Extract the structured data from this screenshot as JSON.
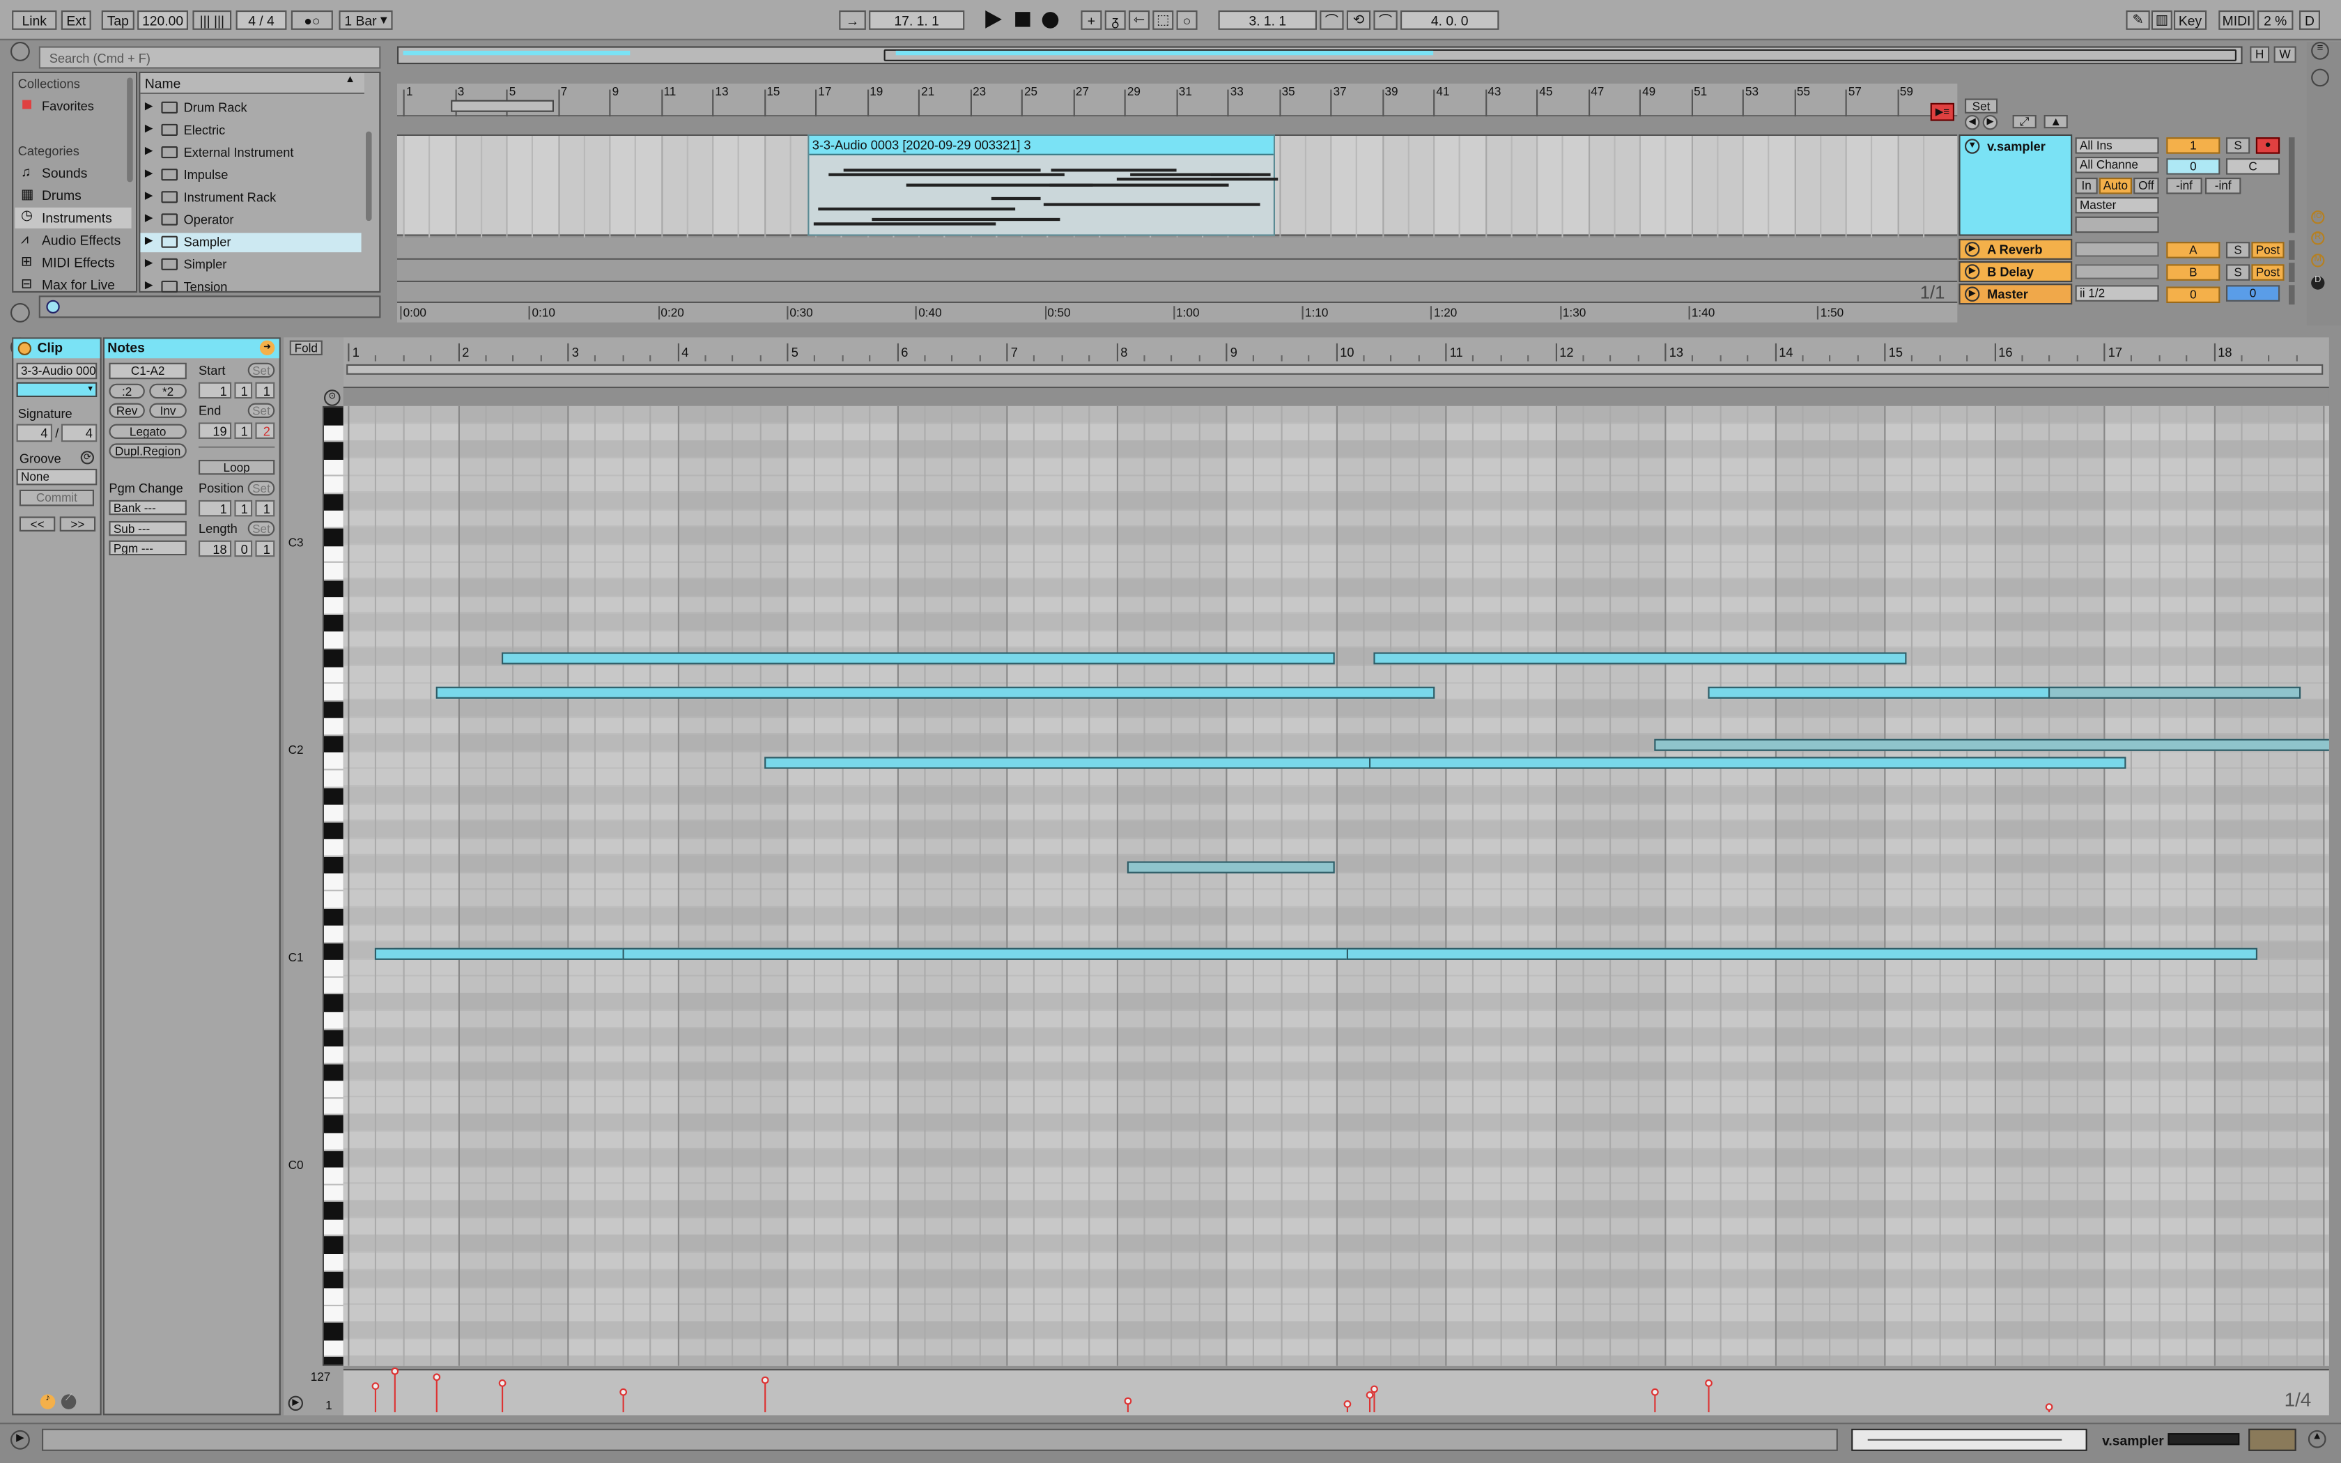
{
  "transport": {
    "link": "Link",
    "ext": "Ext",
    "tap": "Tap",
    "tempo": "120.00",
    "signature": "4 / 4",
    "metronome": "●○",
    "quantize": "1 Bar",
    "position": "17. 1. 1",
    "loop_start": "3. 1. 1",
    "loop_length": "4. 0. 0",
    "key": "Key",
    "midi": "MIDI",
    "cpu": "2 %",
    "disk": "D"
  },
  "browser": {
    "search_placeholder": "Search (Cmd + F)",
    "collections_title": "Collections",
    "favorites": "Favorites",
    "categories_title": "Categories",
    "categories": [
      "Sounds",
      "Drums",
      "Instruments",
      "Audio Effects",
      "MIDI Effects",
      "Max for Live"
    ],
    "name_header": "Name",
    "items": [
      "Drum Rack",
      "Electric",
      "External Instrument",
      "Impulse",
      "Instrument Rack",
      "Operator",
      "Sampler",
      "Simpler",
      "Tension"
    ]
  },
  "arrangement": {
    "bar_labels": [
      "1",
      "3",
      "5",
      "7",
      "9",
      "11",
      "13",
      "15",
      "17",
      "19",
      "21",
      "23",
      "25",
      "27",
      "29",
      "31",
      "33",
      "35",
      "37",
      "39",
      "41",
      "43",
      "45",
      "47",
      "49",
      "51",
      "53",
      "55",
      "57",
      "59"
    ],
    "clip_name": "3-3-Audio 0003 [2020-09-29 003321] 3",
    "time_labels": [
      "0:00",
      "0:10",
      "0:20",
      "0:30",
      "0:40",
      "0:50",
      "1:00",
      "1:10",
      "1:20",
      "1:30",
      "1:40",
      "1:50"
    ],
    "set_label": "Set",
    "page": "1/1",
    "h": "H",
    "w": "W"
  },
  "tracks": {
    "main": {
      "name": "v.sampler",
      "input": "All Ins",
      "channel": "All Channe",
      "in": "In",
      "auto": "Auto",
      "off": "Off",
      "output": "Master",
      "number": "1",
      "s": "S",
      "volume": "0",
      "pan": "C",
      "inf1": "-inf",
      "inf2": "-inf"
    },
    "returns": [
      {
        "name": "A Reverb",
        "letter": "A",
        "s": "S",
        "post": "Post"
      },
      {
        "name": "B Delay",
        "letter": "B",
        "s": "S",
        "post": "Post"
      },
      {
        "name": "Master",
        "letter": "0",
        "s": "",
        "post": "",
        "cue": "ii 1/2"
      }
    ],
    "master_vol": "0"
  },
  "clip_view": {
    "clip_title": "Clip",
    "clip_name": "3-3-Audio 000",
    "signature_label": "Signature",
    "sig_num": "4",
    "sig_den": "4",
    "groove_label": "Groove",
    "groove_value": "None",
    "commit": "Commit",
    "nav_left": "<<",
    "nav_right": ">>"
  },
  "notes_view": {
    "title": "Notes",
    "range": "C1-A2",
    "div2": ":2",
    "mul2": "*2",
    "rev": "Rev",
    "inv": "Inv",
    "legato": "Legato",
    "dupl": "Dupl.Region",
    "pgm_change": "Pgm Change",
    "bank": "Bank ---",
    "sub": "Sub ---",
    "pgm": "Pgm ---",
    "start_label": "Start",
    "start": [
      "1",
      "1",
      "1"
    ],
    "end_label": "End",
    "end": [
      "19",
      "1",
      "2"
    ],
    "loop": "Loop",
    "position_label": "Position",
    "position": [
      "1",
      "1",
      "1"
    ],
    "length_label": "Length",
    "length": [
      "18",
      "0",
      "1"
    ],
    "set": "Set"
  },
  "editor": {
    "fold": "Fold",
    "bar_labels": [
      "1",
      "2",
      "3",
      "4",
      "5",
      "6",
      "7",
      "8",
      "9",
      "10",
      "11",
      "12",
      "13",
      "14",
      "15",
      "16",
      "17",
      "18"
    ],
    "octave_labels": [
      "C3",
      "C2",
      "C1",
      "C0"
    ],
    "vel_max": "127",
    "vel_min": "1",
    "grid": "1/4"
  },
  "notes": [
    {
      "start": 1.42,
      "end": 8.99,
      "row": 10,
      "dim": false
    },
    {
      "start": 1.25,
      "end": 8.25,
      "row": 13,
      "dim": false
    },
    {
      "start": 3.5,
      "end": 10.7,
      "row": 12,
      "dim": false
    },
    {
      "start": 4.8,
      "end": 12.0,
      "row": 5,
      "dim": false
    },
    {
      "start": 10.3,
      "end": 17.2,
      "row": 5,
      "dim": false
    },
    {
      "start": 2.4,
      "end": 10.0,
      "row": 2,
      "dim": false
    },
    {
      "start": 1.8,
      "end": 10.9,
      "row": 3,
      "dim": false
    },
    {
      "start": 8.1,
      "end": 10.0,
      "row": 8,
      "dim": true
    },
    {
      "start": 10.1,
      "end": 18.4,
      "row": 9,
      "dim": false
    },
    {
      "start": 12.9,
      "end": 19.1,
      "row": 4,
      "dim": true
    },
    {
      "start": 10.35,
      "end": 15.2,
      "row": 2,
      "dim": false
    },
    {
      "start": 13.4,
      "end": 18.0,
      "row": 3,
      "dim": false
    },
    {
      "start": 16.5,
      "end": 18.8,
      "row": 3,
      "dim": true
    }
  ],
  "status": {
    "track": "v.sampler"
  },
  "colors": {
    "accent": "#7ae2f5",
    "orange": "#f4b04a",
    "red": "#e04040",
    "bg": "#8f8f8f"
  }
}
